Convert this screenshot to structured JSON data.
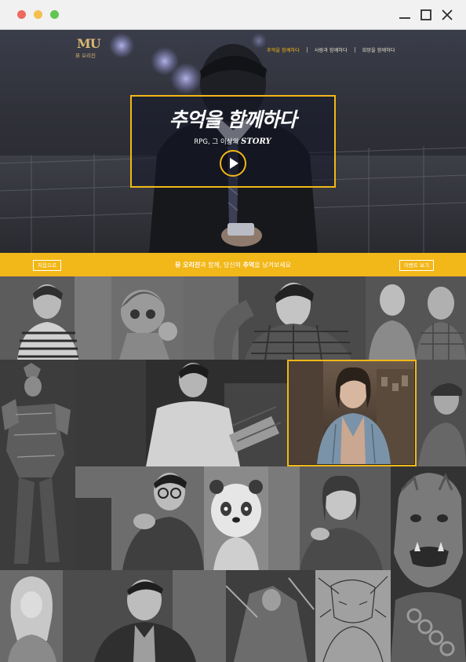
{
  "window": {
    "controls": [
      "close",
      "minimize",
      "zoom"
    ],
    "right_controls": [
      "minimize-icon",
      "maximize-icon",
      "close-icon"
    ]
  },
  "brand": {
    "logo_mark": "MU",
    "logo_sub": "뮤 오리진"
  },
  "nav": {
    "items": [
      {
        "label": "추억을 함께하다",
        "active": true
      },
      {
        "label": "사람과 함께하다",
        "active": false
      },
      {
        "label": "희망을 함께하다",
        "active": false
      }
    ]
  },
  "hero": {
    "title": "추억을 함께하다",
    "subtitle_prefix": "RPG, 그 이상의 ",
    "subtitle_story": "STORY",
    "play_icon": "play-icon"
  },
  "banner": {
    "home_button": "처음으로",
    "event_button": "이벤트 보기",
    "message_1": "뮤 오리진",
    "message_2": "과 함께, 당신의 ",
    "message_3": "추억",
    "message_4": "을 남겨보세요"
  },
  "colors": {
    "accent": "#f2b718",
    "nav_active": "#f4b913",
    "hero_bg": "#2f3038",
    "grid_bg": "#2a2a2a"
  },
  "mosaic": {
    "tile_count": 18,
    "featured_tile": "woman-in-denim-shirt"
  }
}
